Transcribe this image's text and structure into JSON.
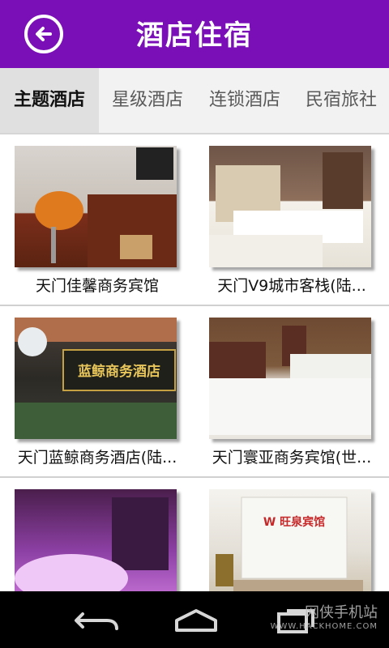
{
  "header": {
    "title": "酒店住宿"
  },
  "tabs": [
    {
      "label": "主题酒店",
      "active": true
    },
    {
      "label": "星级酒店",
      "active": false
    },
    {
      "label": "连锁酒店",
      "active": false
    },
    {
      "label": "民宿旅社",
      "active": false
    }
  ],
  "hotels": [
    {
      "name": "天门佳馨商务宾馆"
    },
    {
      "name": "天门V9城市客栈(陆..."
    },
    {
      "name": "天门蓝鲸商务酒店(陆..."
    },
    {
      "name": "天门寰亚商务宾馆(世..."
    },
    {
      "name": ""
    },
    {
      "name": ""
    }
  ],
  "photo_signs": {
    "hotel3_sign": "蓝鲸商务酒店",
    "hotel6_sign": "W 旺泉宾馆"
  },
  "navbar": {
    "icons": [
      "back-icon",
      "home-icon",
      "recents-icon"
    ],
    "watermark": {
      "line1": "网侠手机站",
      "line2": "WWW.HACKHOME.COM"
    }
  },
  "colors": {
    "header_bg": "#7a0fb7",
    "nav_bg": "#000000",
    "tab_bg": "#f2f2f2",
    "tab_active_bg": "#e0e0e0"
  }
}
